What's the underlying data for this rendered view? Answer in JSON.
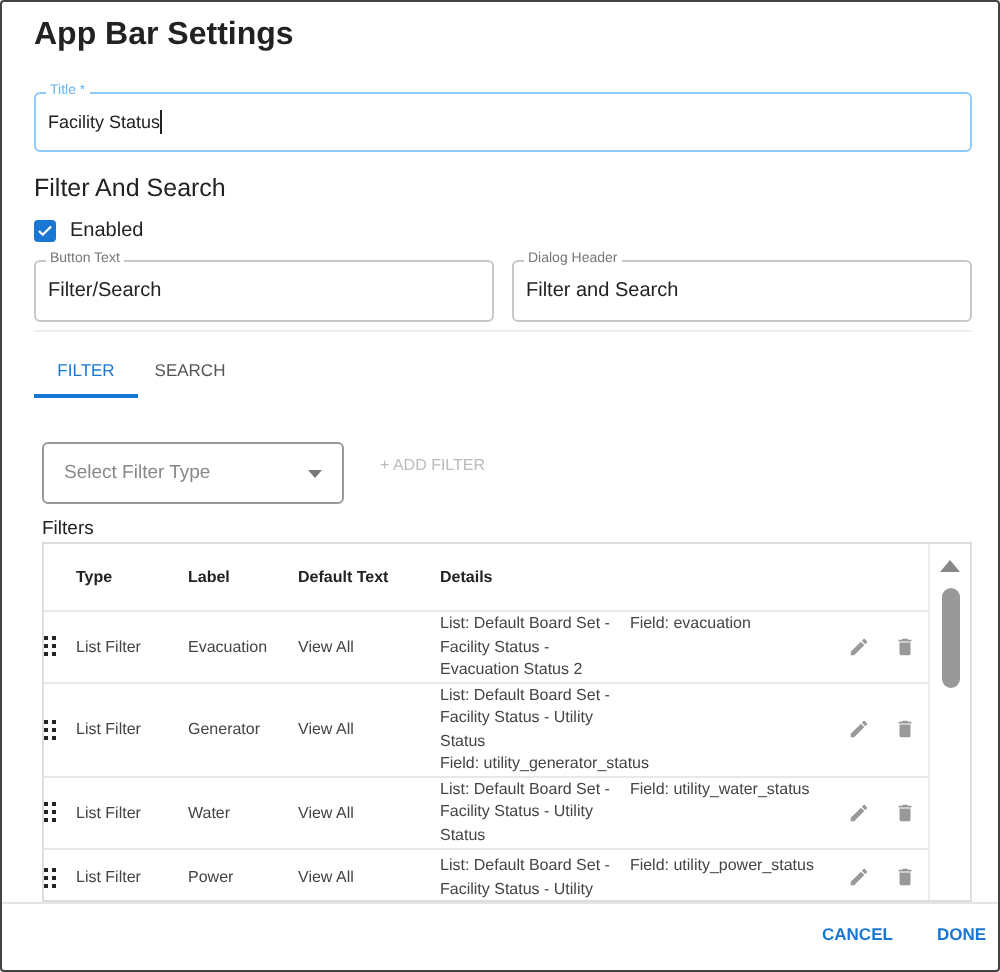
{
  "dialog": {
    "title": "App Bar Settings"
  },
  "title_field": {
    "label": "Title *",
    "value": "Facility Status",
    "focused": true
  },
  "section": {
    "title": "Filter And Search"
  },
  "enabled": {
    "label": "Enabled",
    "checked": true
  },
  "fields": [
    {
      "label": "Button Text",
      "value": "Filter/Search"
    },
    {
      "label": "Dialog Header",
      "value": "Filter and Search"
    }
  ],
  "tabs": [
    {
      "label": "FILTER",
      "selected": true
    },
    {
      "label": "SEARCH",
      "selected": false
    }
  ],
  "filter_type_select": {
    "placeholder": "Select Filter Type"
  },
  "add_filter_button": {
    "label": "+ ADD FILTER",
    "disabled": true
  },
  "filters": {
    "title": "Filters",
    "columns": [
      "Type",
      "Label",
      "Default Text",
      "Details"
    ],
    "rows": [
      {
        "type": "List Filter",
        "label": "Evacuation",
        "default_text": "View All",
        "details": [
          [
            "List: Default Board Set -",
            "Field: evacuation"
          ],
          [
            "Facility Status -"
          ],
          [
            "Evacuation Status 2"
          ]
        ]
      },
      {
        "type": "List Filter",
        "label": "Generator",
        "default_text": "View All",
        "details": [
          [
            "List: Default Board Set -"
          ],
          [
            "Facility Status - Utility"
          ],
          [
            "Status"
          ],
          [
            "Field: utility_generator_status"
          ]
        ]
      },
      {
        "type": "List Filter",
        "label": "Water",
        "default_text": "View All",
        "details": [
          [
            "List: Default Board Set -",
            "Field: utility_water_status"
          ],
          [
            "Facility Status - Utility"
          ],
          [
            "Status"
          ]
        ]
      },
      {
        "type": "List Filter",
        "label": "Power",
        "default_text": "View All",
        "details": [
          [
            "List: Default Board Set -",
            "Field: utility_power_status"
          ],
          [
            "Facility Status - Utility"
          ]
        ]
      }
    ]
  },
  "actions": [
    {
      "label": "CANCEL"
    },
    {
      "label": "DONE"
    }
  ]
}
